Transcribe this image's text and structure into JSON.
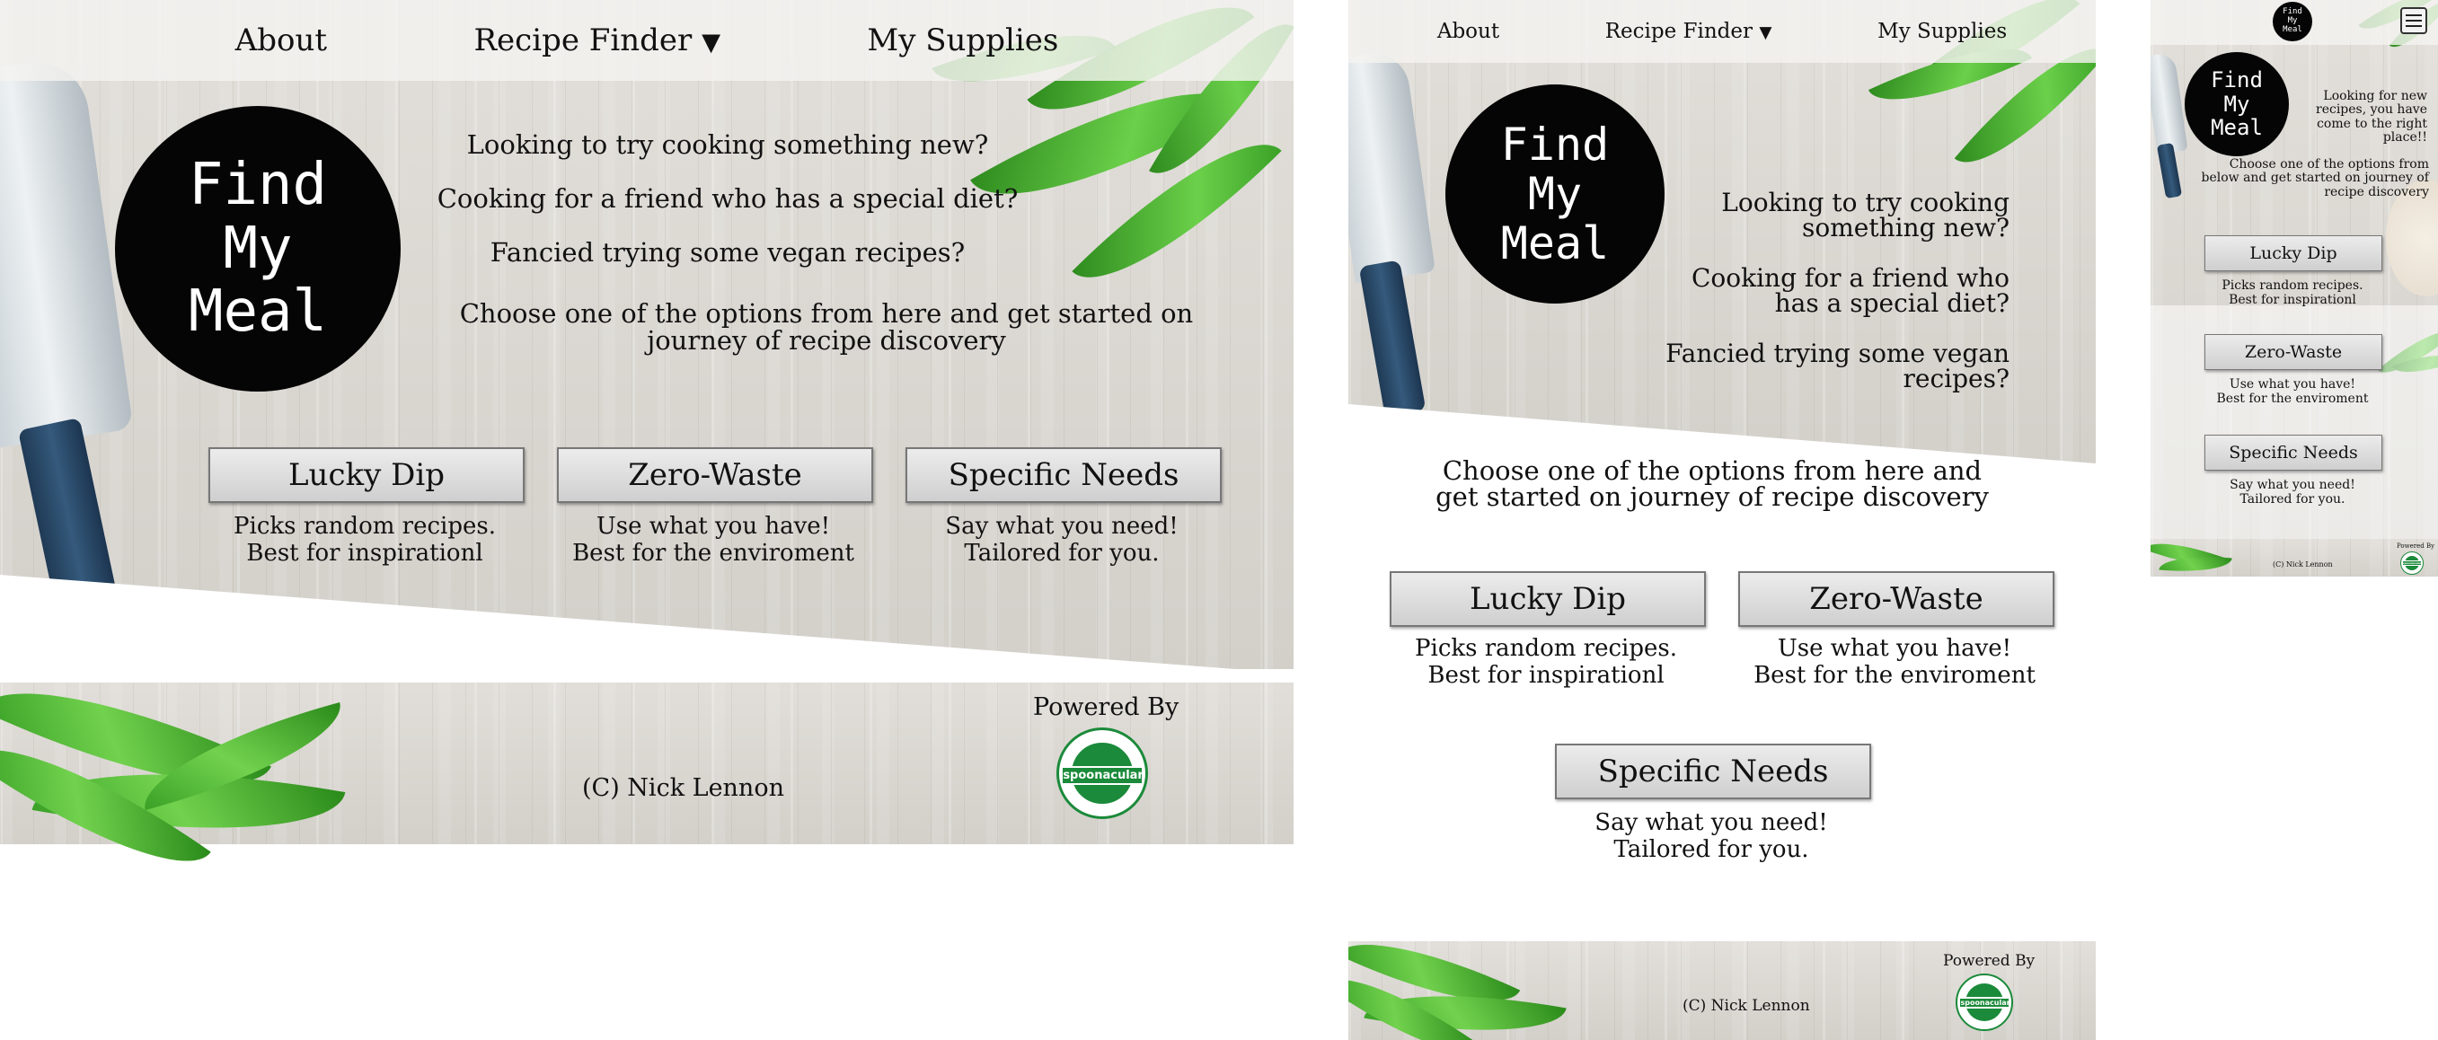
{
  "nav": {
    "about": "About",
    "recipe_finder": "Recipe Finder",
    "caret": "▼",
    "supplies": "My Supplies"
  },
  "logo": {
    "line1": "Find",
    "line2": "My",
    "line3": "Meal"
  },
  "hero": {
    "q1": "Looking to try cooking something new?",
    "q2": "Cooking for a friend who has a special diet?",
    "q3": "Fancied trying some vegan recipes?",
    "cta": "Choose one of the options from here and get started on journey of recipe discovery",
    "mobile_intro": "Looking for new recipes, you have come to the right place!!",
    "mobile_cta": "Choose one of the options from below and get started on journey of recipe discovery"
  },
  "options": [
    {
      "label": "Lucky Dip",
      "desc1": "Picks random recipes.",
      "desc2": "Best for inspirationl"
    },
    {
      "label": "Zero-Waste",
      "desc1": "Use what you have!",
      "desc2": "Best for the enviroment"
    },
    {
      "label": "Specific Needs",
      "desc1": "Say what you need!",
      "desc2": "Tailored for you."
    }
  ],
  "footer": {
    "copyright": "(C) Nick Lennon",
    "powered_by": "Powered By",
    "api_name": "spoonacular"
  },
  "colors": {
    "brand_green": "#1b8a3a",
    "logo_bg": "#050505",
    "button_border": "#777777"
  },
  "icons": {
    "menu": "hamburger-menu-icon",
    "caret": "caret-down-icon",
    "api_logo": "spoonacular-logo-icon"
  }
}
